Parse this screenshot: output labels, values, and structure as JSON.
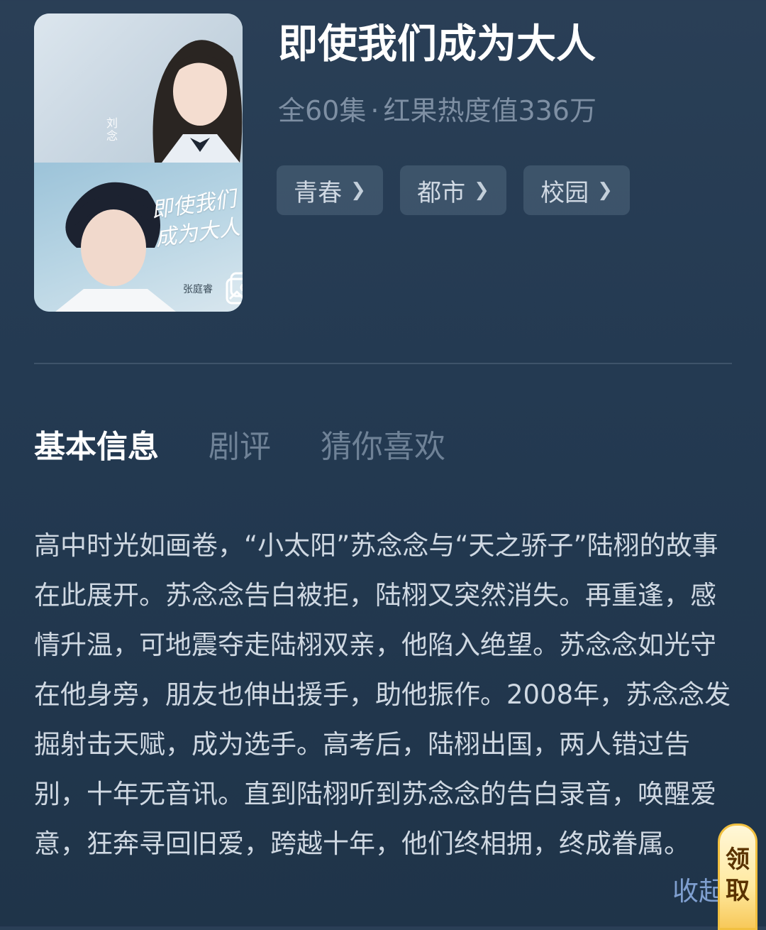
{
  "drama": {
    "title": "即使我们成为大人",
    "episodes": "全60集",
    "separator": "·",
    "heat": "红果热度值336万",
    "tags": [
      {
        "label": "青春"
      },
      {
        "label": "都市"
      },
      {
        "label": "校园"
      }
    ]
  },
  "poster": {
    "caption_top": "刘念",
    "title_script": "即使我们成为大人",
    "caption_bottom": "张庭睿"
  },
  "tabs": [
    {
      "label": "基本信息",
      "active": true
    },
    {
      "label": "剧评",
      "active": false
    },
    {
      "label": "猜你喜欢",
      "active": false
    }
  ],
  "description": {
    "text": "高中时光如画卷，“小太阳”苏念念与“天之骄子”陆栩的故事在此展开。苏念念告白被拒，陆栩又突然消失。再重逢，感情升温，可地震夺走陆栩双亲，他陷入绝望。苏念念如光守在他身旁，朋友也伸出援手，助他振作。2008年，苏念念发掘射击天赋，成为选手。高考后，陆栩出国，两人错过告别，十年无音讯。直到陆栩听到苏念念的告白录音，唤醒爱意，狂奔寻回旧爱，跨越十年，他们终相拥，终成眷属。",
    "collapse_label": "收起"
  },
  "reward": {
    "label_1": "领",
    "label_2": "取"
  },
  "colors": {
    "background": "#243a52",
    "accent_link": "#7f9fd0",
    "muted_text": "#7e8fa3",
    "reward_gold": "#f1c040"
  }
}
